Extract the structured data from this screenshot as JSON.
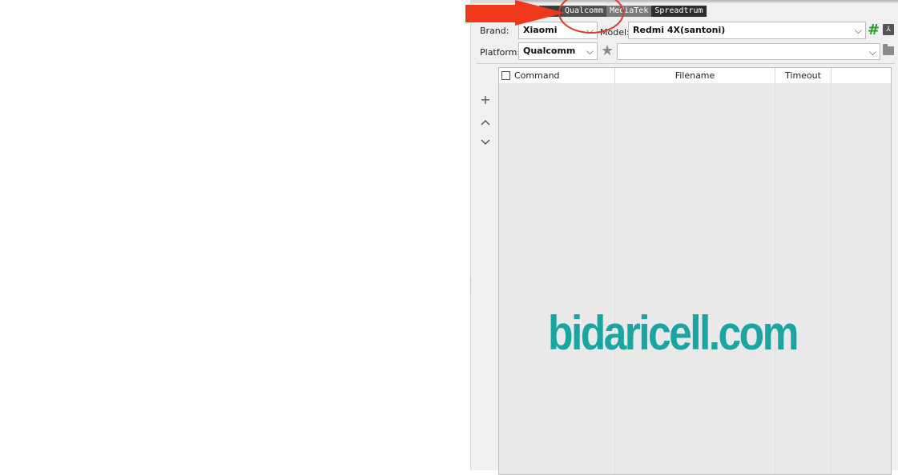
{
  "tabs": [
    {
      "label": ""
    },
    {
      "label": "Qualcomm"
    },
    {
      "label": "MediaTek"
    },
    {
      "label": "Spreadtrum"
    }
  ],
  "form": {
    "brand_label": "Brand:",
    "brand_value": "Xiaomi",
    "model_label": "Model:",
    "model_value": "Redmi 4X(santoni)",
    "platform_label": "Platform:",
    "platform_value": "Qualcomm",
    "preset_value": ""
  },
  "icons": {
    "hash": "#",
    "pdf": "PDF"
  },
  "side_buttons": {
    "add": "+",
    "up": "⌃",
    "down": "⌄"
  },
  "table": {
    "columns": [
      "Command",
      "Filename",
      "Timeout"
    ]
  },
  "watermark": "bidaricell.com",
  "colors": {
    "arrow": "#f0391c",
    "circle": "#d93b2b",
    "watermark": "#1aa5a3",
    "hash": "#22a022"
  }
}
